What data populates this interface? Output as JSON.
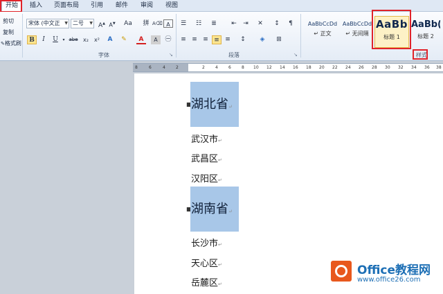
{
  "tabs": [
    "开始",
    "插入",
    "页面布局",
    "引用",
    "邮件",
    "审阅",
    "视图"
  ],
  "clipboard": {
    "cut": "剪切",
    "copy": "复制",
    "format_painter": "格式刷"
  },
  "font_group": {
    "font_name": "宋体 (中文正",
    "font_size": "二号",
    "grow": "A",
    "shrink": "A",
    "change_case": "Aa",
    "bold": "B",
    "italic": "I",
    "underline": "U",
    "strike": "abe",
    "subscript": "x₂",
    "superscript": "x²",
    "label": "字体"
  },
  "paragraph_group": {
    "label": "段落"
  },
  "styles_group": {
    "label": "样式",
    "styles": [
      {
        "sample": "AaBbCcDd",
        "name": "↵ 正文"
      },
      {
        "sample": "AaBbCcDd",
        "name": "↵ 无间隔"
      },
      {
        "sample": "AaBb",
        "name": "标题 1"
      },
      {
        "sample": "AaBb(",
        "name": "标题 2"
      }
    ]
  },
  "ruler_ticks": [
    "8",
    "6",
    "4",
    "2",
    "2",
    "4",
    "6",
    "8",
    "10",
    "12",
    "14",
    "16",
    "18",
    "20",
    "22",
    "24",
    "26",
    "28",
    "30",
    "32",
    "34",
    "36",
    "38"
  ],
  "document": {
    "headings": [
      "湖北省",
      "湖南省"
    ],
    "hubei_items": [
      "武汉市",
      "武昌区",
      "汉阳区"
    ],
    "hunan_items": [
      "长沙市",
      "天心区",
      "岳麓区"
    ],
    "paragraph_mark": "↵"
  },
  "watermark": {
    "title": "Office教程网",
    "url": "www.office26.com"
  },
  "colors": {
    "accent_red": "#e0232a",
    "heading_highlight": "#a8c7e8",
    "watermark_orange": "#e8581d",
    "watermark_blue": "#1d6fb5"
  }
}
